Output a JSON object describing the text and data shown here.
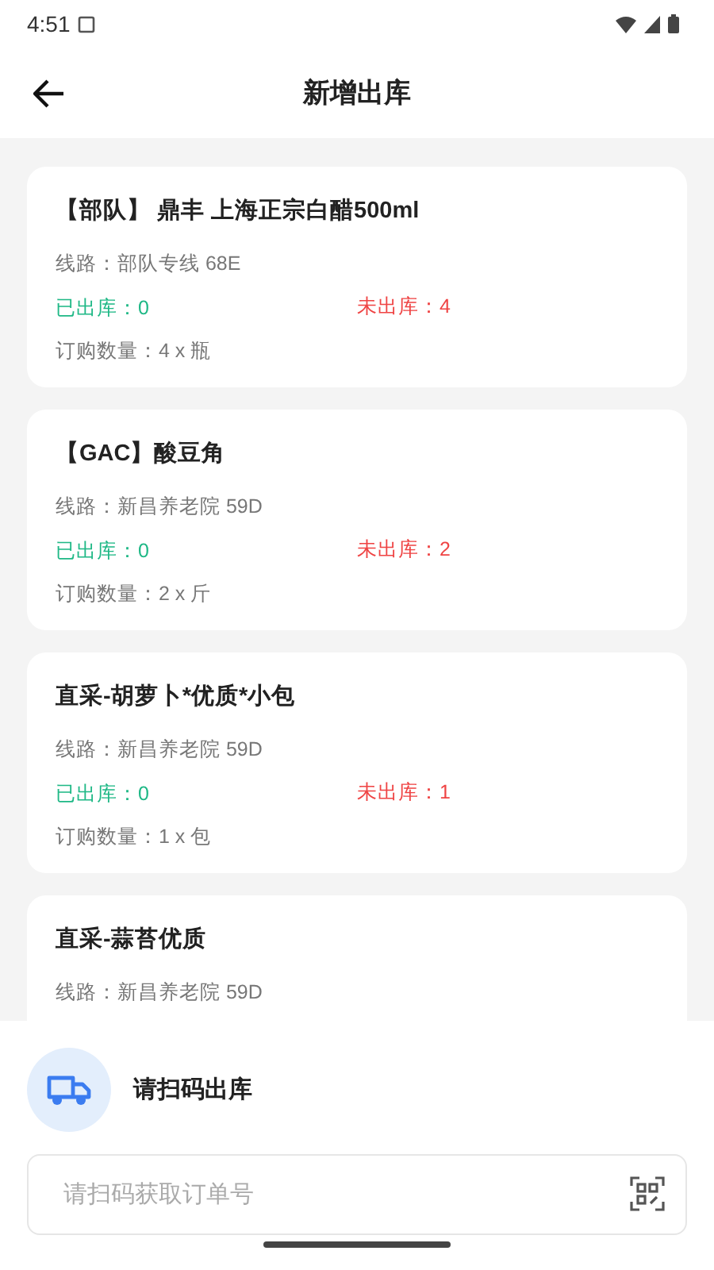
{
  "status_bar": {
    "time": "4:51"
  },
  "header": {
    "title": "新增出库"
  },
  "orders": [
    {
      "title": "【部队】 鼎丰 上海正宗白醋500ml",
      "route": "线路：部队专线 68E",
      "shipped": "已出库：0",
      "pending": "未出库：4",
      "quantity": "订购数量：4 x 瓶"
    },
    {
      "title": "【GAC】酸豆角",
      "route": "线路：新昌养老院 59D",
      "shipped": "已出库：0",
      "pending": "未出库：2",
      "quantity": "订购数量：2 x 斤"
    },
    {
      "title": "直采-胡萝卜*优质*小包",
      "route": "线路：新昌养老院 59D",
      "shipped": "已出库：0",
      "pending": "未出库：1",
      "quantity": "订购数量：1 x 包"
    },
    {
      "title": "直采-蒜苔优质",
      "route": "线路：新昌养老院 59D"
    }
  ],
  "scan_panel": {
    "label": "请扫码出库",
    "input": {
      "placeholder": "请扫码获取订单号"
    }
  }
}
